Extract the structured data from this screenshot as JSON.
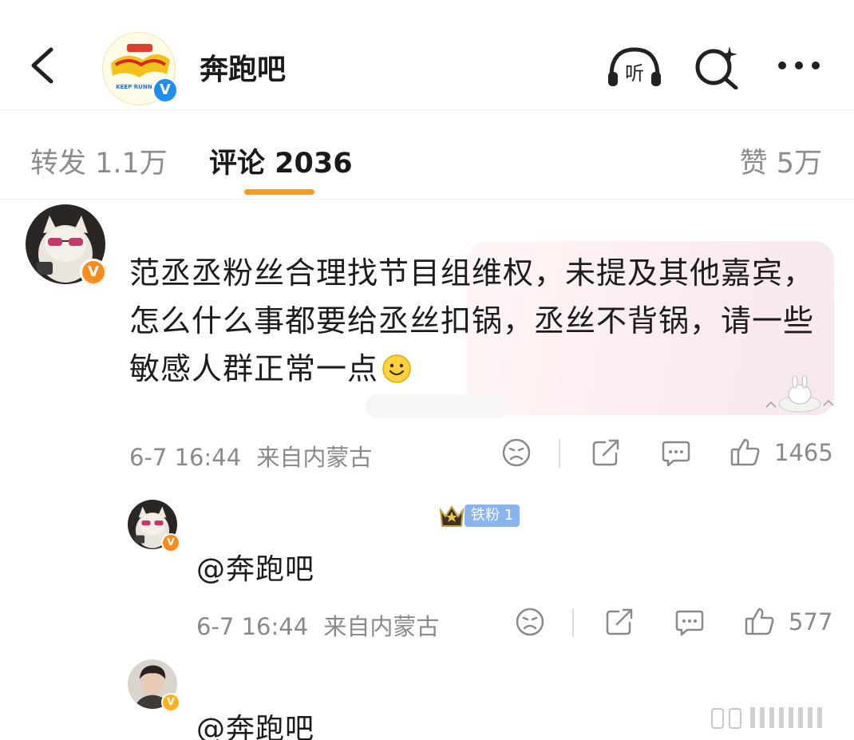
{
  "header": {
    "account_name": "奔跑吧",
    "logo_text": "KEEP RUNNING",
    "listen_label": "听",
    "back_icon": "chevron-left-icon",
    "search_icon": "ai-search-icon",
    "more_icon": "more-dots-icon"
  },
  "tabs": {
    "repost": "转发 1.1万",
    "comments": "评论 2036",
    "likes": "赞 5万",
    "active": "comments"
  },
  "comment": {
    "text": "范丞丞粉丝合理找节目组维权，未提及其他嘉宾，怎么什么事都要给丞丝扣锅，丞丝不背锅，请一些敏感人群正常一点",
    "verified_badge": "V",
    "timestamp": "6-7 16:44",
    "location": "来自内蒙古",
    "like_count": "1465"
  },
  "replies": [
    {
      "fan_level": "铁粉 1",
      "text": "@奔跑吧",
      "timestamp": "6-7 16:44",
      "location": "来自内蒙古",
      "like_count": "577",
      "verified_badge": "V"
    },
    {
      "text": "@奔跑吧",
      "verified_badge": "V"
    }
  ],
  "colors": {
    "accent": "#ff9a1f",
    "verified_blue": "#1f8ef1",
    "verified_orange": "#ff8a1e",
    "meta_gray": "#8a8a8a",
    "bubble_pink": "#fbecef"
  }
}
